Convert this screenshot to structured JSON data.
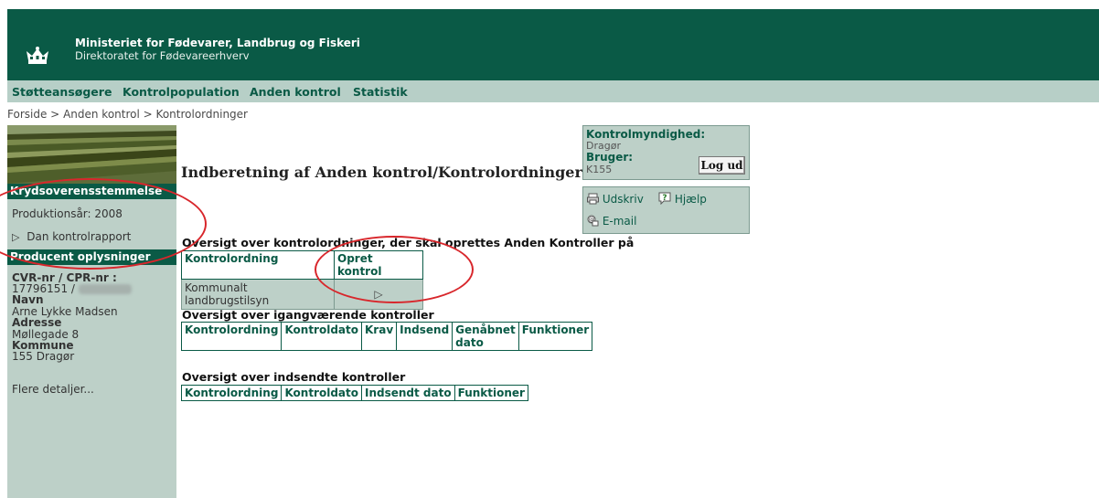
{
  "header": {
    "ministry": "Ministeriet for Fødevarer, Landbrug og Fiskeri",
    "directorate": "Direktoratet for Fødevareerhverv",
    "crown_icon": "crown-icon",
    "bg_color": "#0a5a46"
  },
  "menu": {
    "items": [
      {
        "label": "Støtteansøgere"
      },
      {
        "label": "Kontrolpopulation"
      },
      {
        "label": "Anden kontrol"
      },
      {
        "label": "Statistik"
      }
    ]
  },
  "breadcrumb": {
    "home": "Forside",
    "sep1": ">",
    "level2": "Anden kontrol",
    "sep2": ">",
    "current": "Kontrolordninger"
  },
  "sidebar": {
    "cross_title": "Krydsoverensstemmelse",
    "production_year": "Produktionsår: 2008",
    "report_link": "Dan kontrolrapport",
    "producer_title": "Producent oplysninger",
    "cvr_label": "CVR-nr / CPR-nr :",
    "cvr_value": "17796151 /",
    "name_label": "Navn",
    "name_value": "Arne Lykke Madsen",
    "address_label": "Adresse",
    "address_value": "Møllegade 8",
    "municipality_label": "Kommune",
    "municipality_value": "155 Dragør",
    "more_link": "Flere detaljer..."
  },
  "page": {
    "title": "Indberetning af Anden kontrol/Kontrolordninger"
  },
  "infobox": {
    "authority_label": "Kontrolmyndighed:",
    "authority_value": "Dragør",
    "user_label": "Bruger:",
    "user_value": "K155",
    "logout_label": "Log ud"
  },
  "tools": {
    "print": "Udskriv",
    "help": "Hjælp",
    "email": "E-mail"
  },
  "section1": {
    "title": "Oversigt over kontrolordninger, der skal oprettes Anden Kontroller på",
    "headers": [
      "Kontrolordning",
      "Opret kontrol"
    ],
    "rows": [
      {
        "ordning": "Kommunalt landbrugstilsyn",
        "action": "▷"
      }
    ]
  },
  "section2": {
    "title": "Oversigt over igangværende kontroller",
    "headers": [
      "Kontrolordning",
      "Kontroldato",
      "Krav",
      "Indsend",
      "Genåbnet dato",
      "Funktioner"
    ]
  },
  "section3": {
    "title": "Oversigt over indsendte kontroller",
    "headers": [
      "Kontrolordning",
      "Kontroldato",
      "Indsendt dato",
      "Funktioner"
    ]
  },
  "annotation_color": "#d8262b"
}
